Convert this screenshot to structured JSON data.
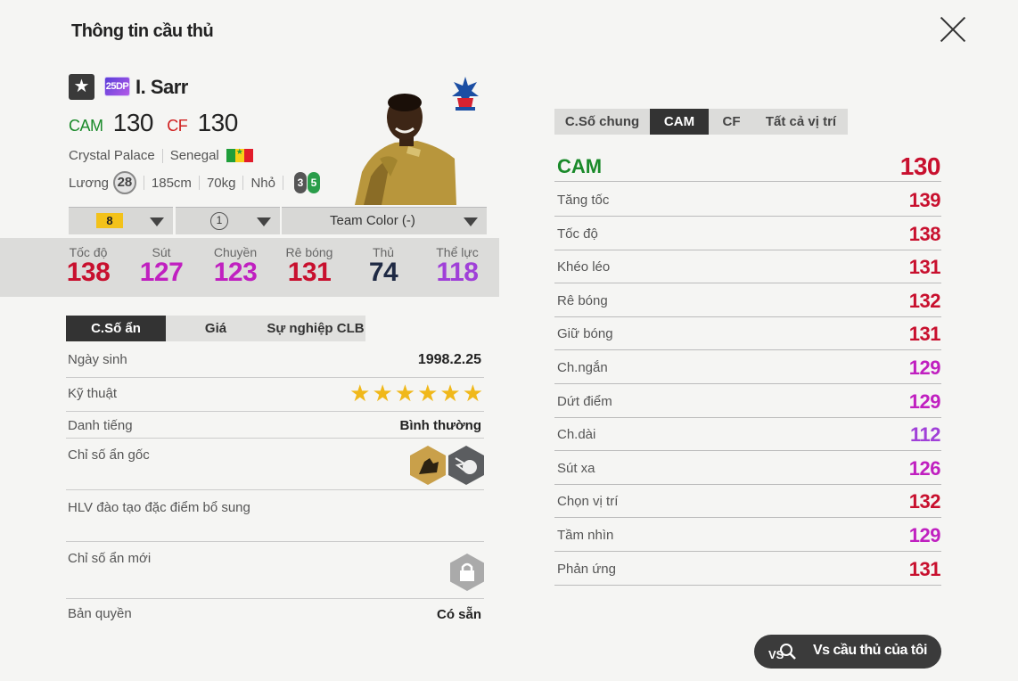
{
  "header": {
    "title": "Thông tin cầu thủ",
    "close_icon": "close-icon"
  },
  "player": {
    "season_badge": "25DP",
    "name": "I. Sarr",
    "positions": [
      {
        "pos": "CAM",
        "ovr": "130"
      },
      {
        "pos": "CF",
        "ovr": "130"
      }
    ],
    "club": "Crystal Palace",
    "nation": "Senegal",
    "salary_label": "Lương",
    "salary": "28",
    "height": "185cm",
    "weight": "70kg",
    "body": "Nhỏ",
    "weak_foot_left": "3",
    "weak_foot_right": "5"
  },
  "selectors": {
    "upgrade_level": "8",
    "team_color_level": "1",
    "team_color": "Team Color (-)"
  },
  "summary_stats": [
    {
      "label": "Tốc độ",
      "value": "138",
      "color": "#c8102e"
    },
    {
      "label": "Sút",
      "value": "127",
      "color": "#c020c0"
    },
    {
      "label": "Chuyền",
      "value": "123",
      "color": "#c020c0"
    },
    {
      "label": "Rê bóng",
      "value": "131",
      "color": "#c8102e"
    },
    {
      "label": "Thủ",
      "value": "74",
      "color": "#1f2a44"
    },
    {
      "label": "Thể lực",
      "value": "118",
      "color": "#a040d8"
    }
  ],
  "left_tabs": [
    "C.Số ẩn",
    "Giá",
    "Sự nghiệp CLB"
  ],
  "details": {
    "birth_label": "Ngày sinh",
    "birth": "1998.2.25",
    "skill_label": "Kỹ thuật",
    "skill_stars": 6,
    "fame_label": "Danh tiếng",
    "fame": "Bình thường",
    "traits_label": "Chỉ số ẩn gốc",
    "coach_label": "HLV đào tạo đặc điểm bổ sung",
    "new_traits_label": "Chỉ số ẩn mới",
    "license_label": "Bản quyền",
    "license": "Có sẵn"
  },
  "right_tabs": [
    "C.Số chung",
    "CAM",
    "CF",
    "Tất cả vị trí"
  ],
  "position_stats": {
    "header_pos": "CAM",
    "header_value": "130",
    "rows": [
      {
        "label": "Tăng tốc",
        "value": "139",
        "color": "#c8102e"
      },
      {
        "label": "Tốc độ",
        "value": "138",
        "color": "#c8102e"
      },
      {
        "label": "Khéo léo",
        "value": "131",
        "color": "#c8102e"
      },
      {
        "label": "Rê bóng",
        "value": "132",
        "color": "#c8102e"
      },
      {
        "label": "Giữ bóng",
        "value": "131",
        "color": "#c8102e"
      },
      {
        "label": "Ch.ngắn",
        "value": "129",
        "color": "#c020c0"
      },
      {
        "label": "Dứt điểm",
        "value": "129",
        "color": "#c020c0"
      },
      {
        "label": "Ch.dài",
        "value": "112",
        "color": "#a040d8"
      },
      {
        "label": "Sút xa",
        "value": "126",
        "color": "#c020c0"
      },
      {
        "label": "Chọn vị trí",
        "value": "132",
        "color": "#c8102e"
      },
      {
        "label": "Tầm nhìn",
        "value": "129",
        "color": "#c020c0"
      },
      {
        "label": "Phản ứng",
        "value": "131",
        "color": "#c8102e"
      }
    ]
  },
  "compare_button": {
    "label": "Vs cầu thủ của tôi",
    "icon": "vs-search-icon"
  }
}
